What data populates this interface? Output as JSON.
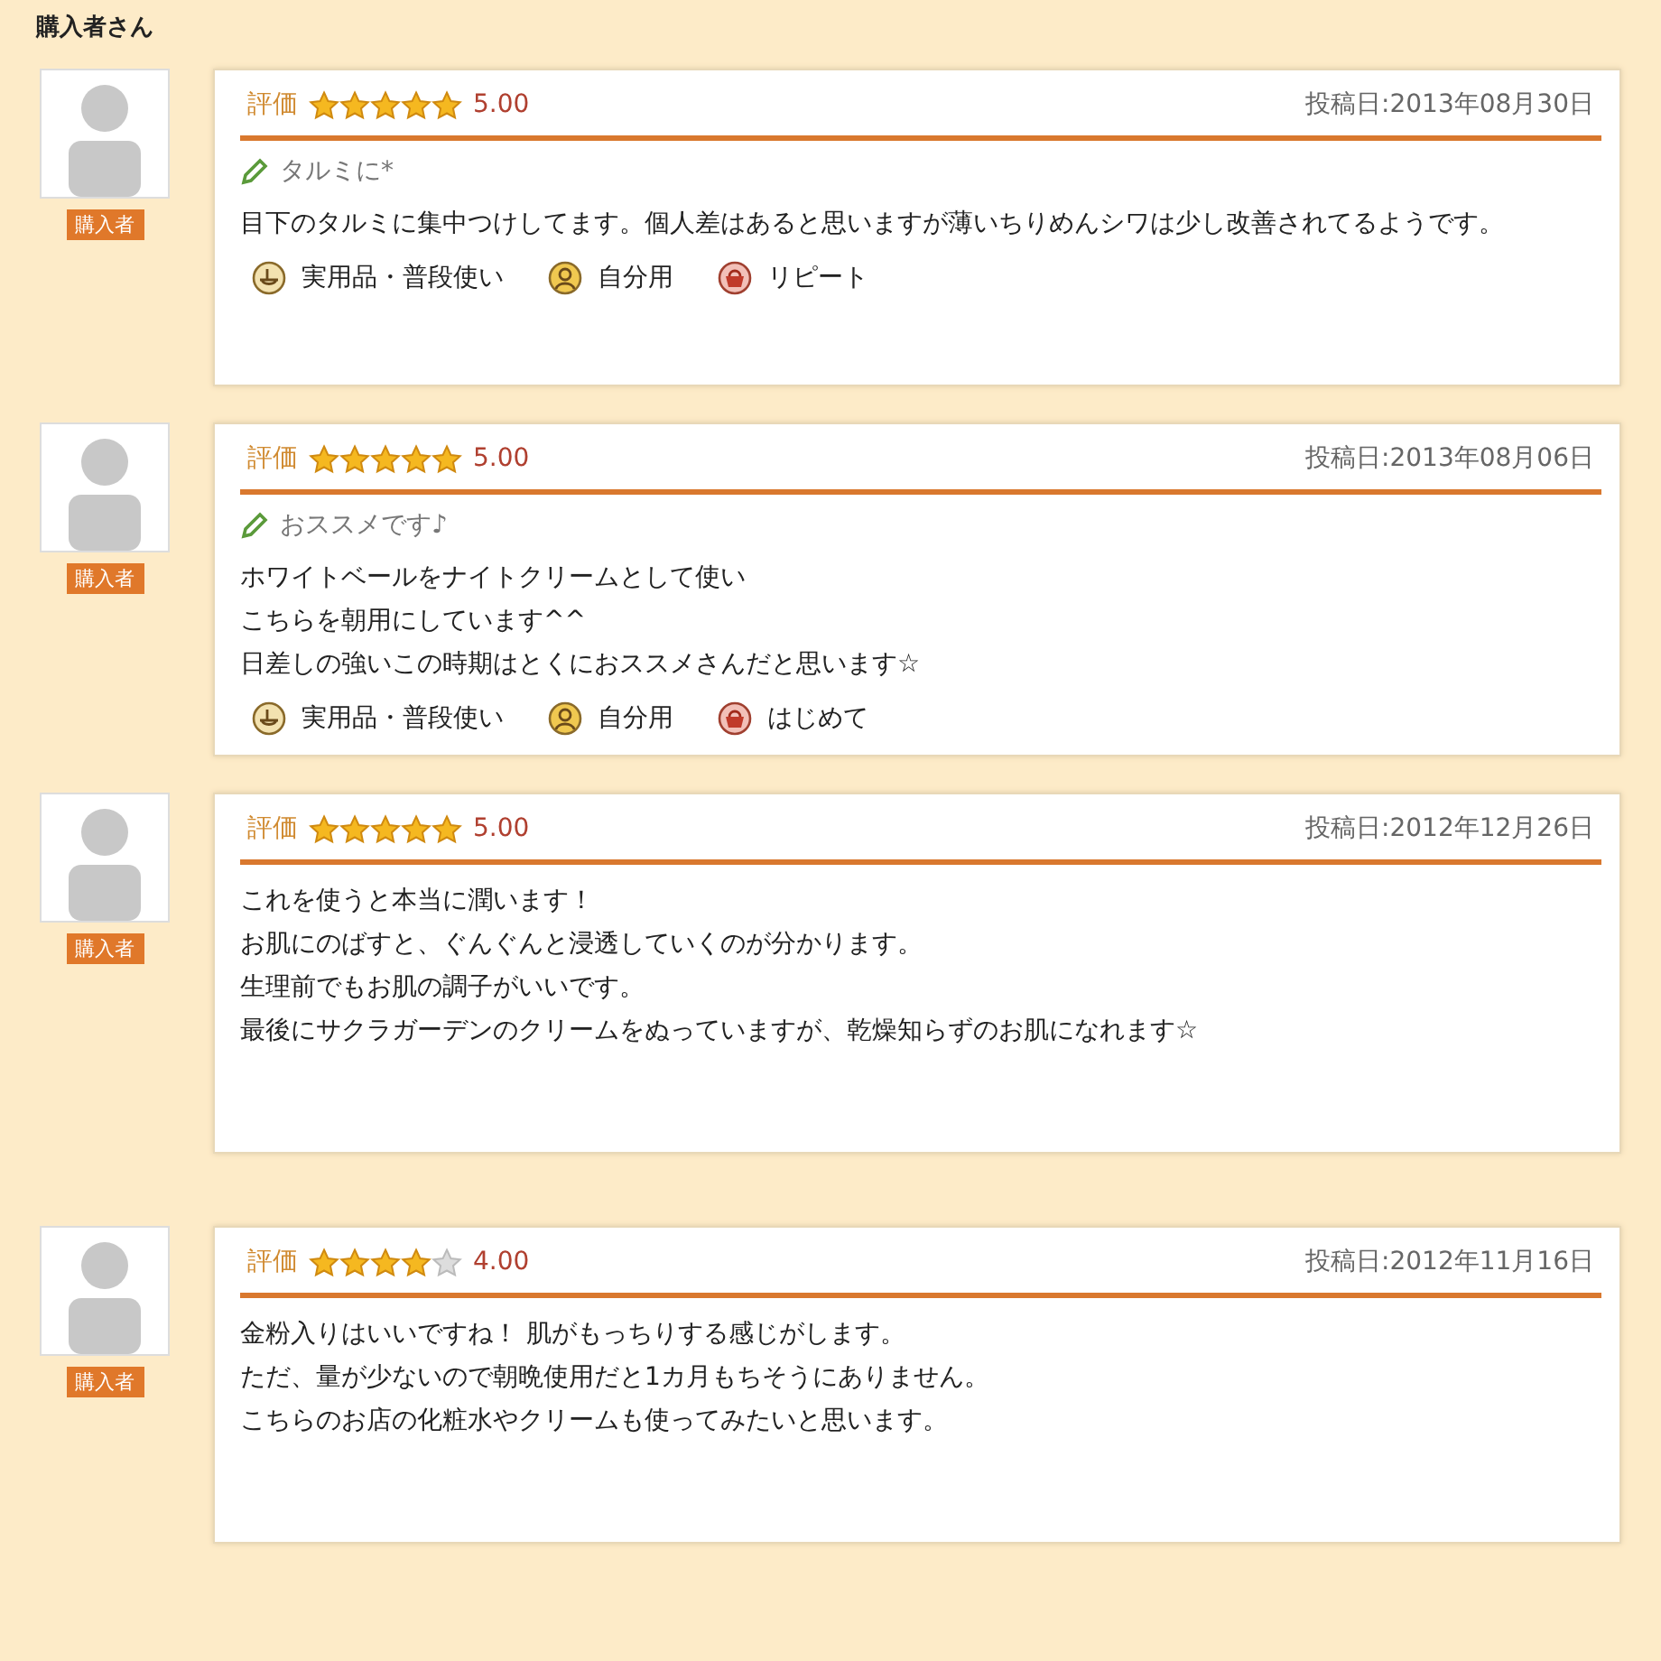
{
  "heading": "購入者さん",
  "reviews": [
    {
      "badge": "購入者",
      "rating_label": "評価",
      "stars": 5,
      "score": "5.00",
      "date": "投稿日:2013年08月30日",
      "title": "タルミに*",
      "body": [
        "目下のタルミに集中つけしてます。個人差はあると思いますが薄いちりめんシワは少し改善されてるようです。"
      ],
      "tags": [
        {
          "kind": "use",
          "label": "実用品・普段使い"
        },
        {
          "kind": "self",
          "label": "自分用"
        },
        {
          "kind": "basket",
          "label": "リピート"
        }
      ]
    },
    {
      "badge": "購入者",
      "rating_label": "評価",
      "stars": 5,
      "score": "5.00",
      "date": "投稿日:2013年08月06日",
      "title": "おススメです♪",
      "body": [
        "ホワイトベールをナイトクリームとして使い",
        "こちらを朝用にしています^^",
        "日差しの強いこの時期はとくにおススメさんだと思います☆"
      ],
      "tags": [
        {
          "kind": "use",
          "label": "実用品・普段使い"
        },
        {
          "kind": "self",
          "label": "自分用"
        },
        {
          "kind": "basket",
          "label": "はじめて"
        }
      ]
    },
    {
      "badge": "購入者",
      "rating_label": "評価",
      "stars": 5,
      "score": "5.00",
      "date": "投稿日:2012年12月26日",
      "body": [
        "これを使うと本当に潤います！",
        "お肌にのばすと、ぐんぐんと浸透していくのが分かります。",
        "生理前でもお肌の調子がいいです。",
        "最後にサクラガーデンのクリームをぬっていますが、乾燥知らずのお肌になれます☆"
      ]
    },
    {
      "badge": "購入者",
      "rating_label": "評価",
      "stars": 4,
      "score": "4.00",
      "date": "投稿日:2012年11月16日",
      "body": [
        "金粉入りはいいですね！ 肌がもっちりする感じがします。",
        "ただ、量が少ないので朝晩使用だと1カ月もちそうにありません。",
        "こちらのお店の化粧水やクリームも使ってみたいと思います。"
      ]
    }
  ]
}
